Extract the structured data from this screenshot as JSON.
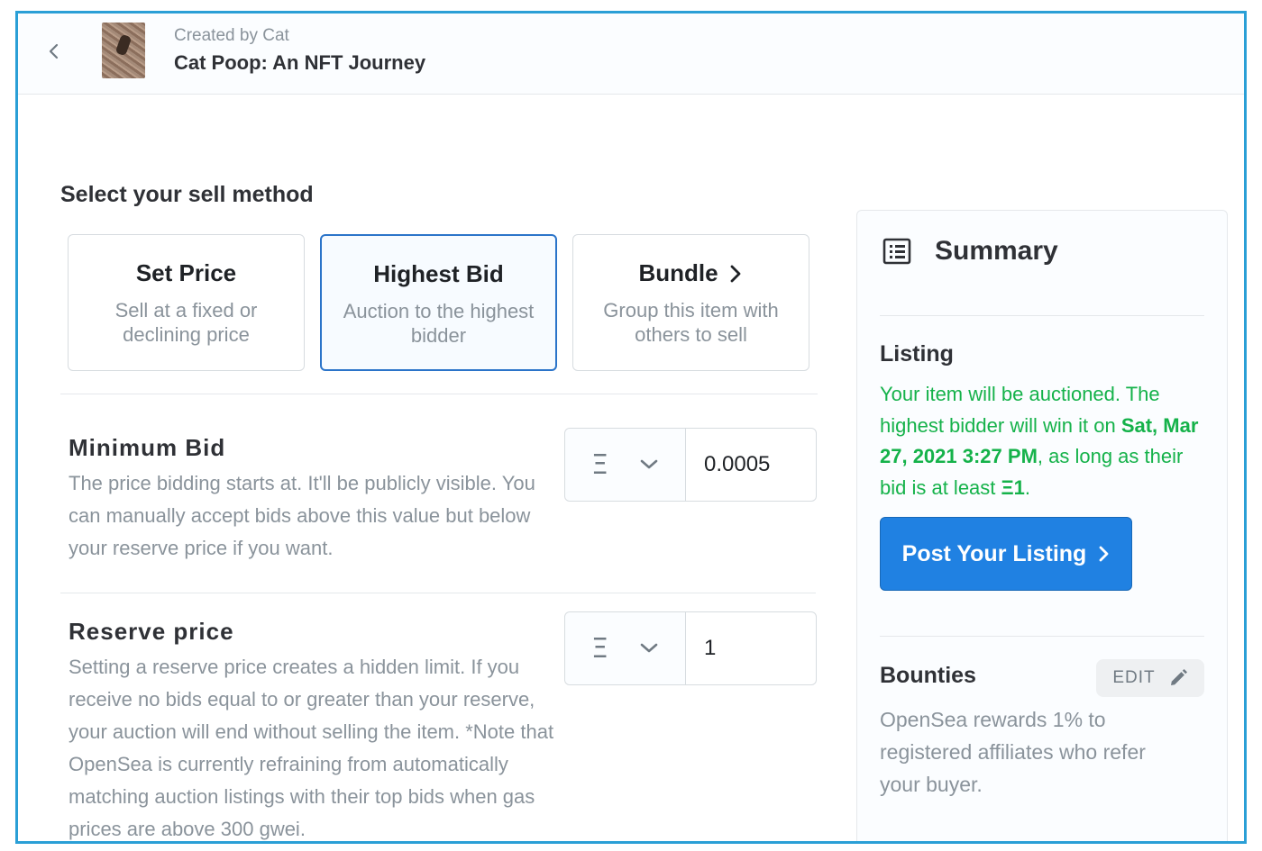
{
  "header": {
    "creator": "Created by Cat",
    "title": "Cat Poop: An NFT Journey"
  },
  "main": {
    "section_title": "Select your sell method",
    "methods": [
      {
        "title": "Set Price",
        "desc": "Sell at a fixed or declining price"
      },
      {
        "title": "Highest Bid",
        "desc": "Auction to the highest bidder"
      },
      {
        "title": "Bundle",
        "desc": "Group this item with others to sell"
      }
    ],
    "minimum_bid": {
      "label": "Minimum Bid",
      "desc": "The price bidding starts at. It'll be publicly visible. You can manually accept bids above this value but below your reserve price if you want.",
      "currency_symbol": "Ξ",
      "value": "0.0005"
    },
    "reserve_price": {
      "label": "Reserve price",
      "desc": "Setting a reserve price creates a hidden limit. If you receive no bids equal to or greater than your reserve, your auction will end without selling the item. *Note that OpenSea is currently refraining from automatically matching auction listings with their top bids when gas prices are above 300 gwei.",
      "currency_symbol": "Ξ",
      "value": "1"
    }
  },
  "summary": {
    "title": "Summary",
    "listing_label": "Listing",
    "listing_text_1": "Your item will be auctioned. The highest bidder will win it on ",
    "listing_date": "Sat, Mar 27, 2021 3:27 PM",
    "listing_text_2": ", as long as their bid is at least ",
    "listing_min": "Ξ1",
    "listing_text_3": ".",
    "post_button": "Post Your Listing",
    "bounties_label": "Bounties",
    "edit_button": "EDIT",
    "bounties_text": "OpenSea rewards 1% to registered affiliates who refer your buyer."
  },
  "colors": {
    "accent": "#2081e2",
    "selected_border": "#2b74c9",
    "success_text": "#15b24a",
    "frame_border": "#2a9fd6"
  }
}
